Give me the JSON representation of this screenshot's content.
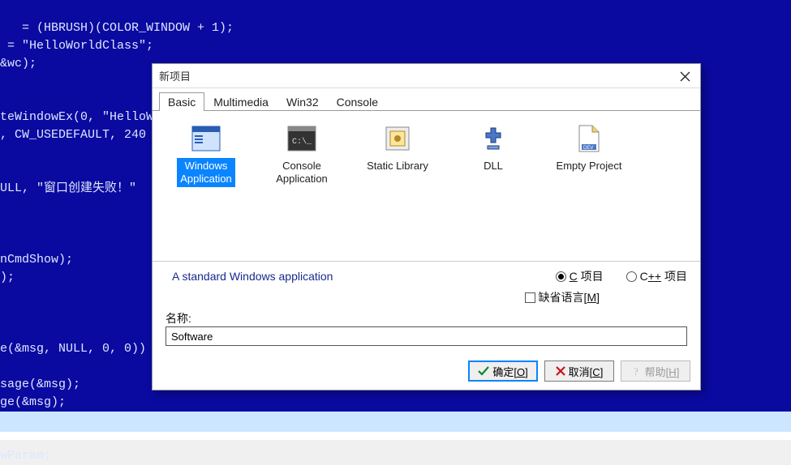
{
  "background_code": " = (HBRUSH)(COLOR_WINDOW + 1);\n = \"HelloWorldClass\";\n&wc);\n\n\nteWindowEx(0, \"HelloW\n, CW_USEDEFAULT, 240\n\n\nULL, \"窗口创建失败！\"\n\n\n\nnCmdShow);\n);\n\n\n\ne(&msg, NULL, 0, 0))\n\nsage(&msg);\nge(&msg);\n\n\nwParam;",
  "dialog": {
    "title": "新项目",
    "tabs": [
      "Basic",
      "Multimedia",
      "Win32",
      "Console"
    ],
    "active_tab_index": 0,
    "templates": [
      {
        "label": "Windows\nApplication",
        "icon": "window-icon",
        "selected": true
      },
      {
        "label": "Console\nApplication",
        "icon": "console-icon",
        "selected": false
      },
      {
        "label": "Static Library",
        "icon": "library-icon",
        "selected": false
      },
      {
        "label": "DLL",
        "icon": "dll-icon",
        "selected": false
      },
      {
        "label": "Empty Project",
        "icon": "file-icon",
        "selected": false
      }
    ],
    "description": "A standard Windows application",
    "radio_c_label_pre": "C",
    "radio_c_label_post": " 项目",
    "radio_cpp_label_pre": "C",
    "radio_cpp_label_post": " 项目",
    "radio_cpp_inner": "++",
    "default_lang_pre": "缺省语言[",
    "default_lang_key": "M",
    "default_lang_post": "]",
    "name_label": "名称:",
    "name_value": "Software",
    "buttons": {
      "ok_pre": "确定[",
      "ok_key": "O",
      "ok_post": "]",
      "cancel_pre": "取消[",
      "cancel_key": "C",
      "cancel_post": "]",
      "help_pre": "帮助[",
      "help_key": "H",
      "help_post": "]"
    },
    "radio_selected": "c",
    "default_lang_checked": false
  }
}
